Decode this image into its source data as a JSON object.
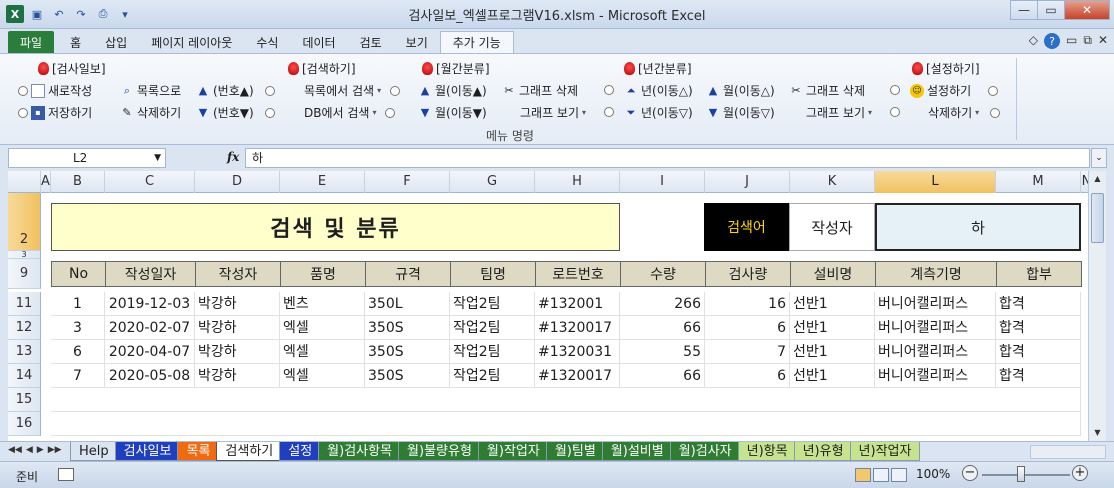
{
  "window": {
    "title": "검사일보_엑셀프로그램V16.xlsm - Microsoft Excel",
    "excel_logo": "X"
  },
  "tabs": [
    "파일",
    "홈",
    "삽입",
    "페이지 레이아웃",
    "수식",
    "데이터",
    "검토",
    "보기",
    "추가 기능"
  ],
  "active_tab": "추가 기능",
  "ribbon": {
    "group_label": "메뉴 명령",
    "g1_title": "[검사일보]",
    "g1_new": "새로작성",
    "g1_save": "저장하기",
    "g1_tolist": "목록으로",
    "g1_delete": "삭제하기",
    "g1_num_up": "(번호▲)",
    "g1_num_down": "(번호▼)",
    "g2_title": "[검색하기]",
    "g2_list_search": "목록에서 검색",
    "g2_db_search": "DB에서 검색",
    "g3_title": "[월간분류]",
    "g3_month_up": "월(이동▲)",
    "g3_month_down": "월(이동▼)",
    "g3_graph_del": "그래프 삭제",
    "g3_graph_view": "그래프 보기",
    "g4_title": "[년간분류]",
    "g4_year_up": "년(이동△)",
    "g4_year_down": "년(이동▽)",
    "g4_month_up": "월(이동△)",
    "g4_month_down": "월(이동▽)",
    "g4_graph_del": "그래프 삭제",
    "g4_graph_view": "그래프 보기",
    "g5_title": "[설정하기]",
    "g5_settings": "설정하기",
    "g5_delete": "삭제하기"
  },
  "formula_bar": {
    "name_box": "L2",
    "fx": "fx",
    "value": "하"
  },
  "columns": [
    "A",
    "B",
    "C",
    "D",
    "E",
    "F",
    "G",
    "H",
    "I",
    "J",
    "K",
    "L",
    "M",
    "N"
  ],
  "selected_column": "L",
  "rows": [
    "2",
    "3",
    "9",
    "11",
    "12",
    "13",
    "14",
    "15",
    "16"
  ],
  "sheet": {
    "title": "검색 및 분류",
    "search_label": "검색어",
    "search_field": "작성자",
    "search_value": "하",
    "headers": [
      "No",
      "작성일자",
      "작성자",
      "품명",
      "규격",
      "팀명",
      "로트번호",
      "수량",
      "검사량",
      "설비명",
      "계측기명",
      "합부"
    ],
    "data": [
      [
        "1",
        "2019-12-03",
        "박강하",
        "벤츠",
        "350L",
        "작업2팀",
        "#132001",
        "266",
        "16",
        "선반1",
        "버니어캘리퍼스",
        "합격"
      ],
      [
        "3",
        "2020-02-07",
        "박강하",
        "엑셀",
        "350S",
        "작업2팀",
        "#1320017",
        "66",
        "6",
        "선반1",
        "버니어캘리퍼스",
        "합격"
      ],
      [
        "6",
        "2020-04-07",
        "박강하",
        "엑셀",
        "350S",
        "작업2팀",
        "#1320031",
        "55",
        "7",
        "선반1",
        "버니어캘리퍼스",
        "합격"
      ],
      [
        "7",
        "2020-05-08",
        "박강하",
        "엑셀",
        "350S",
        "작업2팀",
        "#1320017",
        "66",
        "6",
        "선반1",
        "버니어캘리퍼스",
        "합격"
      ]
    ]
  },
  "sheet_tabs": [
    {
      "label": "Help",
      "bg": "#dbe5f1",
      "fg": "#1e1e1e"
    },
    {
      "label": "검사일보",
      "bg": "#1f3fbf",
      "fg": "#ffffff"
    },
    {
      "label": "목록",
      "bg": "#f06a10",
      "fg": "#ffffff"
    },
    {
      "label": "검색하기",
      "bg": "#ffffff",
      "fg": "#1e1e1e"
    },
    {
      "label": "설정",
      "bg": "#1f3fbf",
      "fg": "#ffffff"
    },
    {
      "label": "월)검사항목",
      "bg": "#2e7d32",
      "fg": "#ffffff"
    },
    {
      "label": "월)불량유형",
      "bg": "#2e7d32",
      "fg": "#ffffff"
    },
    {
      "label": "월)작업자",
      "bg": "#2e7d32",
      "fg": "#ffffff"
    },
    {
      "label": "월)팀별",
      "bg": "#2e7d32",
      "fg": "#ffffff"
    },
    {
      "label": "월)설비별",
      "bg": "#2e7d32",
      "fg": "#ffffff"
    },
    {
      "label": "월)검사자",
      "bg": "#2e7d32",
      "fg": "#ffffff"
    },
    {
      "label": "년)항목",
      "bg": "#c6e38f",
      "fg": "#1e1e1e"
    },
    {
      "label": "년)유형",
      "bg": "#c6e38f",
      "fg": "#1e1e1e"
    },
    {
      "label": "년)작업자",
      "bg": "#c6e38f",
      "fg": "#1e1e1e"
    }
  ],
  "status": {
    "ready": "준비",
    "zoom": "100%"
  }
}
